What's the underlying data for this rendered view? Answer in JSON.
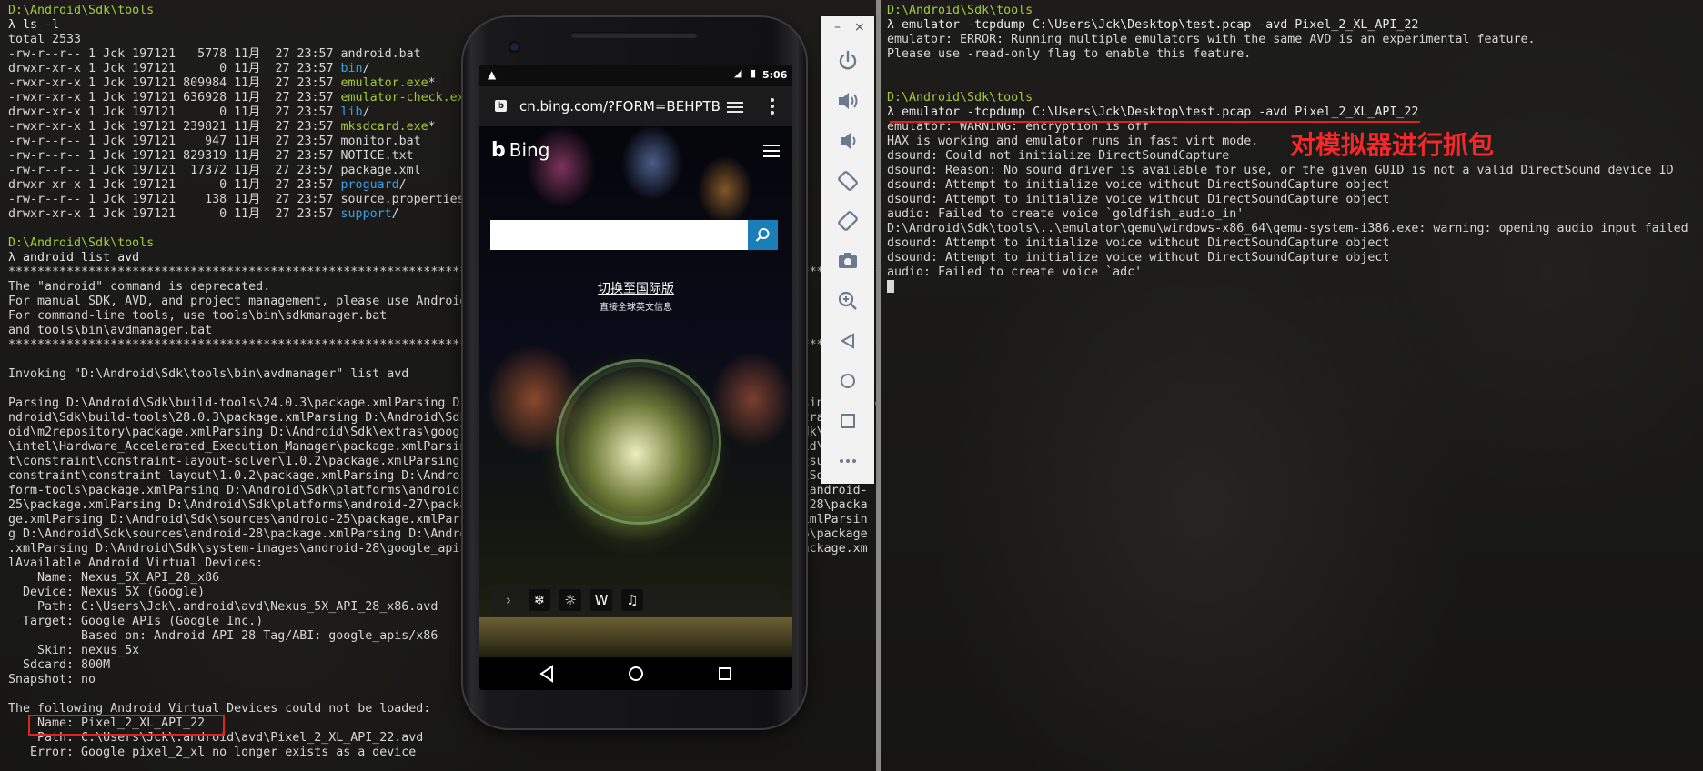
{
  "left_terminal": {
    "lines": [
      [
        {
          "t": "D:\\Android\\Sdk\\tools",
          "c": "path"
        }
      ],
      [
        {
          "t": "λ ls -l",
          "c": "prompt"
        }
      ],
      [
        {
          "t": "total 2533"
        }
      ],
      [
        {
          "t": "-rw-r--r-- 1 Jck 197121   5778 11月  27 23:57 android.bat"
        }
      ],
      [
        {
          "t": "drwxr-xr-x 1 Jck 197121      0 11月  27 23:57 "
        },
        {
          "t": "bin",
          "c": "dir"
        },
        {
          "t": "/"
        }
      ],
      [
        {
          "t": "-rwxr-xr-x 1 Jck 197121 809984 11月  27 23:57 "
        },
        {
          "t": "emulator.exe",
          "c": "exe"
        },
        {
          "t": "*"
        }
      ],
      [
        {
          "t": "-rwxr-xr-x 1 Jck 197121 636928 11月  27 23:57 "
        },
        {
          "t": "emulator-check.exe",
          "c": "exe"
        }
      ],
      [
        {
          "t": "drwxr-xr-x 1 Jck 197121      0 11月  27 23:57 "
        },
        {
          "t": "lib",
          "c": "dir"
        },
        {
          "t": "/"
        }
      ],
      [
        {
          "t": "-rwxr-xr-x 1 Jck 197121 239821 11月  27 23:57 "
        },
        {
          "t": "mksdcard.exe",
          "c": "exe"
        },
        {
          "t": "*"
        }
      ],
      [
        {
          "t": "-rw-r--r-- 1 Jck 197121    947 11月  27 23:57 monitor.bat"
        }
      ],
      [
        {
          "t": "-rw-r--r-- 1 Jck 197121 829319 11月  27 23:57 NOTICE.txt"
        }
      ],
      [
        {
          "t": "-rw-r--r-- 1 Jck 197121  17372 11月  27 23:57 package.xml"
        }
      ],
      [
        {
          "t": "drwxr-xr-x 1 Jck 197121      0 11月  27 23:57 "
        },
        {
          "t": "proguard",
          "c": "dir"
        },
        {
          "t": "/"
        }
      ],
      [
        {
          "t": "-rw-r--r-- 1 Jck 197121    138 11月  27 23:57 source.properties"
        }
      ],
      [
        {
          "t": "drwxr-xr-x 1 Jck 197121      0 11月  27 23:57 "
        },
        {
          "t": "support",
          "c": "dir"
        },
        {
          "t": "/"
        }
      ],
      [
        {
          "t": ""
        }
      ],
      [
        {
          "t": "D:\\Android\\Sdk\\tools",
          "c": "path"
        }
      ],
      [
        {
          "t": "λ android list avd",
          "c": "prompt"
        }
      ],
      [
        {
          "t": "**************************************************************************************************************************"
        }
      ],
      [
        {
          "t": "The \"android\" command is deprecated."
        }
      ],
      [
        {
          "t": "For manual SDK, AVD, and project management, please use Android Studio."
        }
      ],
      [
        {
          "t": "For command-line tools, use tools\\bin\\sdkmanager.bat"
        }
      ],
      [
        {
          "t": "and tools\\bin\\avdmanager.bat"
        }
      ],
      [
        {
          "t": "**************************************************************************************************************************"
        }
      ],
      [
        {
          "t": ""
        }
      ],
      [
        {
          "t": "Invoking \"D:\\Android\\Sdk\\tools\\bin\\avdmanager\" list avd"
        }
      ],
      [
        {
          "t": ""
        }
      ],
      [
        {
          "t": "Parsing D:\\Android\\Sdk\\build-tools\\24.0.3\\package.xmlParsing D:\\Android\\Sdk\\build-tools\\26.0.2\\package.xmlParsing D:\\Andr"
        }
      ],
      [
        {
          "t": "ndroid\\Sdk\\build-tools\\28.0.3\\package.xmlParsing D:\\Android\\Sdk\\emulator\\package.xmlParsing D:\\Android\\Sdk\\extras\\andr"
        }
      ],
      [
        {
          "t": "oid\\m2repository\\package.xmlParsing D:\\Android\\Sdk\\extras\\google\\m2repository\\package.xmlParsing D:\\Android\\Sdk\\extras"
        }
      ],
      [
        {
          "t": "\\intel\\Hardware_Accelerated_Execution_Manager\\package.xmlParsing D:\\Android\\Sdk\\extras\\m2repository\\com\\android\\suppor"
        }
      ],
      [
        {
          "t": "t\\constraint\\constraint-layout-solver\\1.0.2\\package.xmlParsing D:\\Android\\Sdk\\extras\\m2repository\\com\\android\\support\\"
        }
      ],
      [
        {
          "t": "constraint\\constraint-layout\\1.0.2\\package.xmlParsing D:\\Android\\Sdk\\patcher\\v4\\package.xmlParsing D:\\Android\\Sdk\\plat"
        }
      ],
      [
        {
          "t": "form-tools\\package.xmlParsing D:\\Android\\Sdk\\platforms\\android-22\\package.xmlParsing D:\\Android\\Sdk\\platforms\\android-"
        }
      ],
      [
        {
          "t": "25\\package.xmlParsing D:\\Android\\Sdk\\platforms\\android-27\\package.xmlParsing D:\\Android\\Sdk\\platforms\\android-28\\packa"
        }
      ],
      [
        {
          "t": "ge.xmlParsing D:\\Android\\Sdk\\sources\\android-25\\package.xmlParsing D:\\Android\\Sdk\\sources\\android-27\\package.xmlParsin"
        }
      ],
      [
        {
          "t": "g D:\\Android\\Sdk\\sources\\android-28\\package.xmlParsing D:\\Android\\Sdk\\system-images\\android-22\\google_apis\\x86\\package"
        }
      ],
      [
        {
          "t": ".xmlParsing D:\\Android\\Sdk\\system-images\\android-28\\google_apis\\x86\\package.xmlParsing D:\\Android\\Sdk\\tools\\package.xm"
        }
      ],
      [
        {
          "t": "lAvailable Android Virtual Devices:"
        }
      ],
      [
        {
          "t": "    Name: Nexus_5X_API_28_x86"
        }
      ],
      [
        {
          "t": "  Device: Nexus 5X (Google)"
        }
      ],
      [
        {
          "t": "    Path: C:\\Users\\Jck\\.android\\avd\\Nexus_5X_API_28_x86.avd"
        }
      ],
      [
        {
          "t": "  Target: Google APIs (Google Inc.)"
        }
      ],
      [
        {
          "t": "          Based on: Android API 28 Tag/ABI: google_apis/x86"
        }
      ],
      [
        {
          "t": "    Skin: nexus_5x"
        }
      ],
      [
        {
          "t": "  Sdcard: 800M"
        }
      ],
      [
        {
          "t": "Snapshot: no"
        }
      ],
      [
        {
          "t": ""
        }
      ],
      [
        {
          "t": "The following Android Virtual Devices could not be loaded:"
        }
      ],
      [
        {
          "t": "    Name: Pixel_2_XL_API_22"
        }
      ],
      [
        {
          "t": "    Path: C:\\Users\\Jck\\.android\\avd\\Pixel_2_XL_API_22.avd"
        }
      ],
      [
        {
          "t": "   Error: Google pixel_2_xl no longer exists as a device"
        }
      ]
    ]
  },
  "right_terminal": {
    "lines": [
      [
        {
          "t": "D:\\Android\\Sdk\\tools",
          "c": "path"
        }
      ],
      [
        {
          "t": "λ emulator -tcpdump C:\\Users\\Jck\\Desktop\\test.pcap -avd Pixel_2_XL_API_22",
          "c": "prompt"
        }
      ],
      [
        {
          "t": "emulator: ERROR: Running multiple emulators with the same AVD is an experimental feature."
        }
      ],
      [
        {
          "t": "Please use -read-only flag to enable this feature."
        }
      ],
      [
        {
          "t": ""
        }
      ],
      [
        {
          "t": ""
        }
      ],
      [
        {
          "t": "D:\\Android\\Sdk\\tools",
          "c": "path"
        }
      ],
      [
        {
          "t": "λ emulator -tcpdump C:\\Users\\Jck\\Desktop\\test.pcap -avd Pixel_2_XL_API_22",
          "c": "prompt"
        }
      ],
      [
        {
          "t": "emulator: WARNING: encryption is off"
        }
      ],
      [
        {
          "t": "HAX is working and emulator runs in fast virt mode."
        }
      ],
      [
        {
          "t": "dsound: Could not initialize DirectSoundCapture"
        }
      ],
      [
        {
          "t": "dsound: Reason: No sound driver is available for use, or the given GUID is not a valid DirectSound device ID"
        }
      ],
      [
        {
          "t": "dsound: Attempt to initialize voice without DirectSoundCapture object"
        }
      ],
      [
        {
          "t": "dsound: Attempt to initialize voice without DirectSoundCapture object"
        }
      ],
      [
        {
          "t": "audio: Failed to create voice `goldfish_audio_in'"
        }
      ],
      [
        {
          "t": "D:\\Android\\Sdk\\tools\\..\\emulator\\qemu\\windows-x86_64\\qemu-system-i386.exe: warning: opening audio input failed"
        }
      ],
      [
        {
          "t": "dsound: Attempt to initialize voice without DirectSoundCapture object"
        }
      ],
      [
        {
          "t": "dsound: Attempt to initialize voice without DirectSoundCapture object"
        }
      ],
      [
        {
          "t": "audio: Failed to create voice `adc'"
        }
      ]
    ],
    "annotation": "对模拟器进行抓包"
  },
  "phone": {
    "status": {
      "warning_icon": "warning-icon",
      "time": "5:06"
    },
    "browser": {
      "url": "cn.bing.com/?FORM=BEHPTB",
      "favicon_letter": "b"
    },
    "bing": {
      "logo_mark": "b",
      "logo_text": "Bing",
      "intl_link": "切换至国际版",
      "intl_sub": "直接全球英文信息"
    },
    "bottom_icons": [
      "chevron-right-icon",
      "snowflake-icon",
      "lightbulb-icon",
      "w-icon",
      "bell-icon"
    ],
    "nav": [
      "back-icon",
      "home-icon",
      "recents-icon"
    ]
  },
  "emulator_toolbar": {
    "window_buttons": {
      "minimize": "–",
      "close": "×"
    },
    "buttons": [
      "power-icon",
      "volume-up-icon",
      "volume-down-icon",
      "rotate-left-icon",
      "rotate-right-icon",
      "camera-icon",
      "zoom-icon",
      "back-icon",
      "home-icon",
      "overview-icon",
      "more-icon"
    ]
  },
  "colors": {
    "accent_red": "#e0231b",
    "path_green": "#a6c93a",
    "dir_blue": "#3aa0e8",
    "bing_blue": "#1a7fb8"
  }
}
